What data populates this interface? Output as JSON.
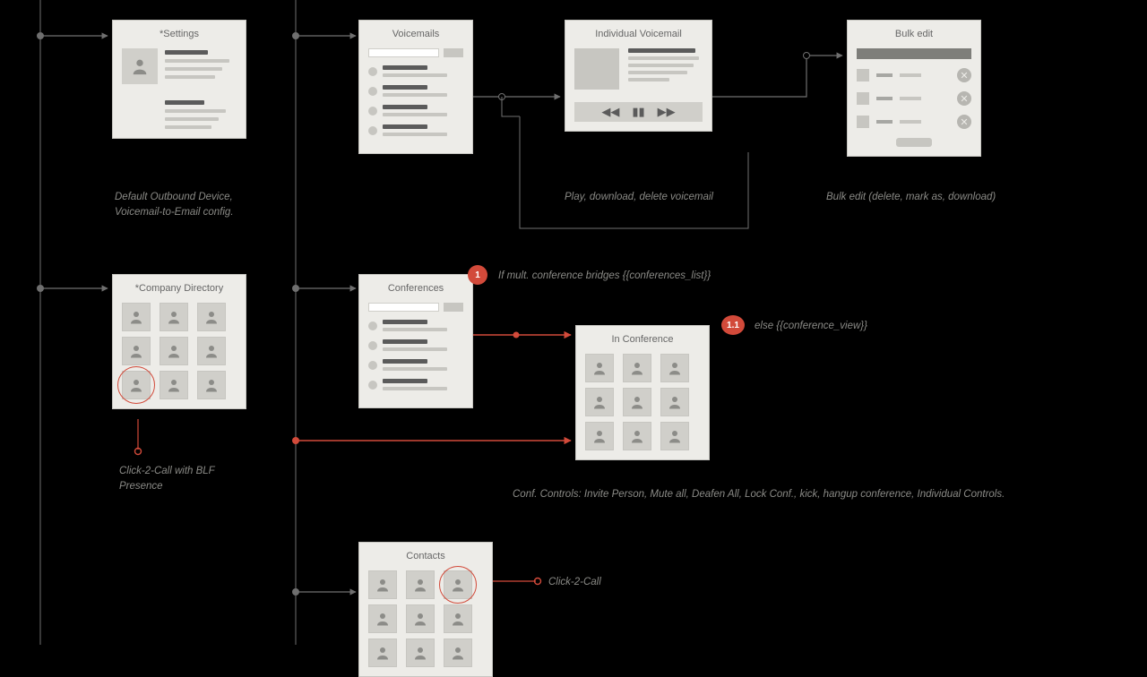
{
  "cards": {
    "settings": {
      "title": "*Settings"
    },
    "directory": {
      "title": "*Company Directory"
    },
    "voicemails": {
      "title": "Voicemails"
    },
    "ind_voicemail": {
      "title": "Individual Voicemail"
    },
    "bulk_edit": {
      "title": "Bulk edit"
    },
    "conferences": {
      "title": "Conferences"
    },
    "in_conference": {
      "title": "In Conference"
    },
    "contacts": {
      "title": "Contacts"
    }
  },
  "captions": {
    "settings": "Default Outbound Device, Voicemail-to-Email config.",
    "directory": "Click-2-Call with BLF Presence",
    "ind_voicemail": "Play, download, delete voicemail",
    "bulk_edit": "Bulk edit (delete, mark as, download)",
    "conf_note_1": "If mult. conference bridges {{conferences_list}}",
    "conf_note_11": "else {{conference_view}}",
    "conf_controls": "Conf. Controls: Invite Person, Mute all, Deafen All, Lock Conf., kick, hangup conference,  Individual Controls.",
    "contacts": "Click-2-Call"
  },
  "badges": {
    "one": "1",
    "one_one": "1.1"
  },
  "player_glyphs": {
    "prev": "◀◀",
    "pause": "▮▮",
    "next": "▶▶"
  },
  "colors": {
    "accent": "#d24a3a",
    "line_gray": "#6f6f6f"
  }
}
